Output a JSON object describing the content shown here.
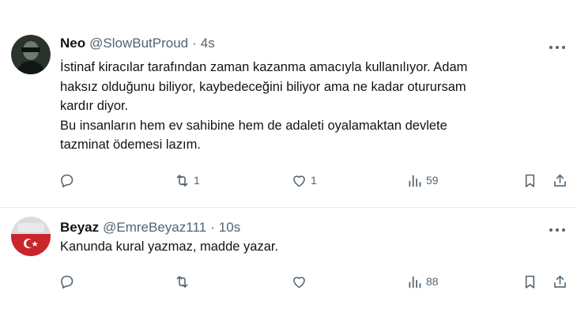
{
  "tweets": [
    {
      "name": "Neo",
      "handle": "@SlowButProud",
      "separator": "·",
      "time": "4s",
      "lines": [
        "İstinaf kiracılar tarafından zaman kazanma amacıyla kullanılıyor. Adam",
        "haksız olduğunu biliyor, kaybedeceğini biliyor ama ne kadar oturursam",
        "kardır diyor.",
        "Bu insanların hem ev sahibine hem de adaleti oyalamaktan devlete",
        "tazminat ödemesi lazım."
      ],
      "retweets": "1",
      "likes": "1",
      "views": "59",
      "avatar_icon": "neo-avatar"
    },
    {
      "name": "Beyaz",
      "handle": "@EmreBeyaz111",
      "separator": "·",
      "time": "10s",
      "lines": [
        "Kanunda kural yazmaz, madde yazar."
      ],
      "retweets": "",
      "likes": "",
      "views": "88",
      "avatar_icon": "flag-avatar"
    }
  ],
  "icons": [
    "reply-icon",
    "retweet-icon",
    "like-icon",
    "views-icon",
    "bookmark-icon",
    "share-icon",
    "more-icon"
  ],
  "colors": {
    "text": "#0f1419",
    "secondary": "#536471",
    "divider": "#e9ecef"
  }
}
